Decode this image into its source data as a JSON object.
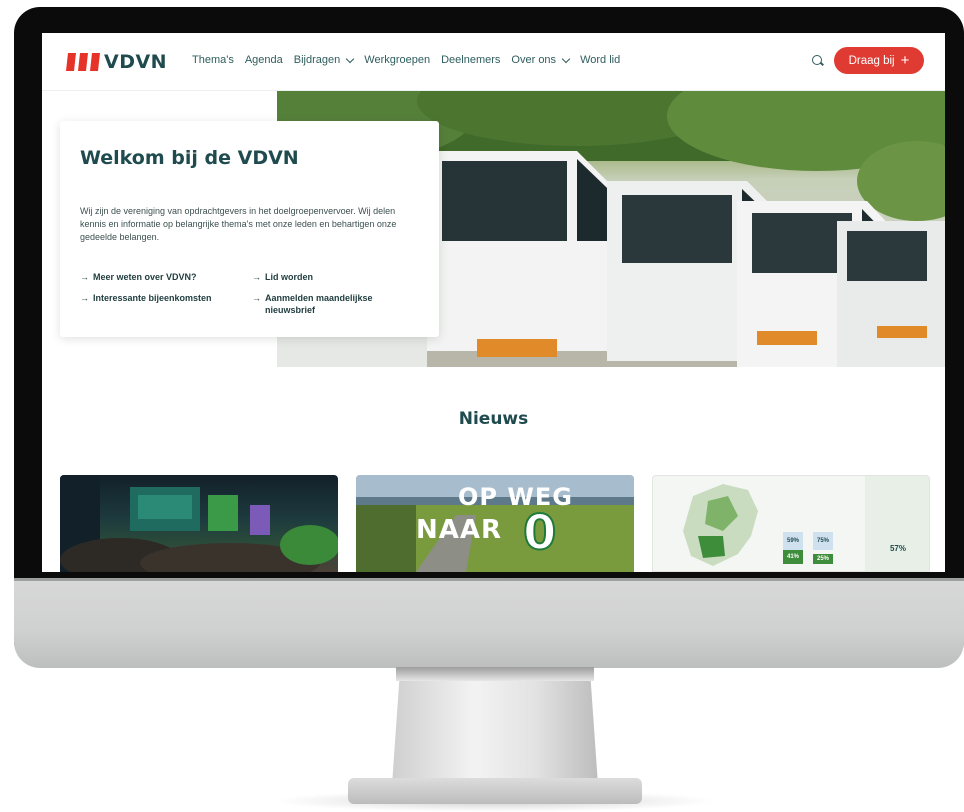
{
  "nav": {
    "logo_text": "VDVN",
    "items": [
      {
        "label": "Thema's",
        "dropdown": false
      },
      {
        "label": "Agenda",
        "dropdown": false
      },
      {
        "label": "Bijdragen",
        "dropdown": true
      },
      {
        "label": "Werkgroepen",
        "dropdown": false
      },
      {
        "label": "Deelnemers",
        "dropdown": false
      },
      {
        "label": "Over ons",
        "dropdown": true
      },
      {
        "label": "Word lid",
        "dropdown": false
      }
    ],
    "search_icon": "search-icon",
    "cta_label": "Draag bij",
    "cta_icon": "+"
  },
  "colors": {
    "primary": "#1f4b4e",
    "accent": "#e03b32",
    "logo_red": "#e63329"
  },
  "hero": {
    "title": "Welkom bij de VDVN",
    "text": "Wij zijn de vereniging van opdrachtgevers in het doelgroepenvervoer. Wij delen kennis en informatie op belangrijke thema's met onze leden en behartigen onze gedeelde belangen.",
    "links": [
      {
        "label": "Meer weten over VDVN?"
      },
      {
        "label": "Lid worden"
      },
      {
        "label": "Interessante bijeenkomsten"
      },
      {
        "label": "Aanmelden maandelijkse nieuwsbrief"
      }
    ],
    "arrow": "→"
  },
  "news": {
    "title": "Nieuws",
    "cards": [
      {
        "image": "conference-audience-photo"
      },
      {
        "image": "op-weg-naar-0-road-photo",
        "line1": "OP WEG",
        "line2": "NAAR",
        "big": "0"
      },
      {
        "image": "netherlands-map-infographic",
        "stats": [
          "59%",
          "75%",
          "41%",
          "25%",
          "57%"
        ]
      }
    ]
  }
}
